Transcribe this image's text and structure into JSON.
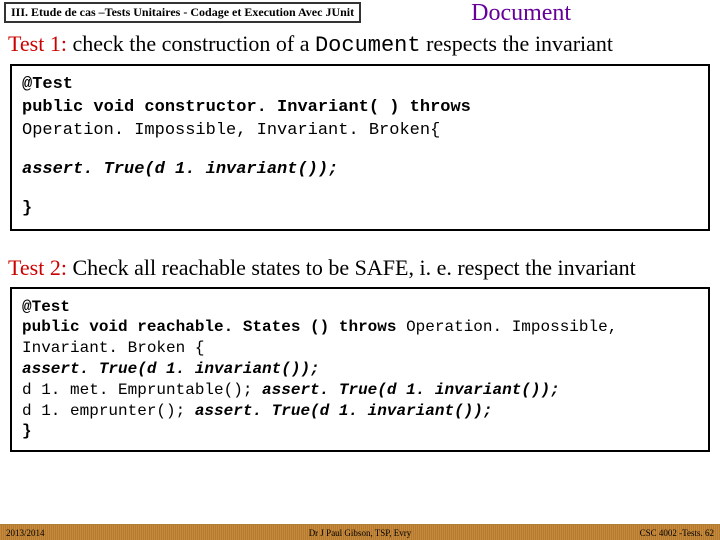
{
  "header": {
    "section_label": "III. Etude de cas –Tests Unitaires - Codage et Execution Avec JUnit",
    "doc_title": "Document"
  },
  "test1": {
    "name": "Test 1:",
    "desc_before": "   check the construction of a ",
    "class_name": "Document",
    "desc_after": " respects the invariant",
    "code": {
      "l1": "@Test",
      "l2a": "public void ",
      "l2b": "constructor. Invariant( ) ",
      "l2c": "throws",
      "l3": "Operation. Impossible, Invariant. Broken{",
      "l4": "assert. True(d 1. invariant());",
      "l5": "}"
    }
  },
  "test2": {
    "name": "Test 2:",
    "desc": " Check all reachable states to be SAFE, i. e. respect the invariant",
    "code": {
      "l1": "@Test",
      "l2a": "public void ",
      "l2b": "reachable. States () ",
      "l2c": "throws ",
      "l2d": "Operation. Impossible,",
      "l3": "Invariant. Broken {",
      "l4": "assert. True(d 1. invariant());",
      "l5a": "d 1. met. Empruntable(); ",
      "l5b": "assert. True(d 1. invariant());",
      "l6a": "d 1. emprunter(); ",
      "l6b": "assert. True(d 1. invariant());",
      "l7": "}"
    }
  },
  "footer": {
    "left": "2013/2014",
    "center": "Dr J Paul Gibson, TSP, Evry",
    "right": "CSC 4002 -Tests. 62"
  }
}
